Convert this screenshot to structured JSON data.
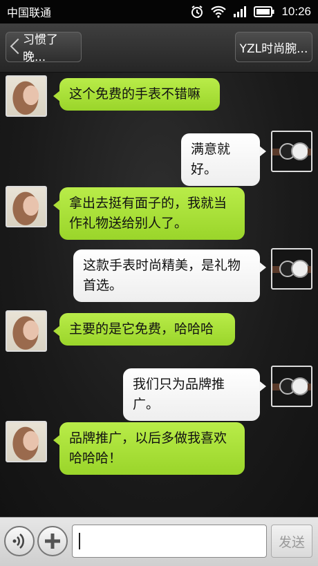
{
  "status_bar": {
    "carrier": "中国联通",
    "time": "10:26",
    "icons": [
      "alarm-icon",
      "wifi-icon",
      "signal-icon",
      "battery-icon"
    ]
  },
  "header": {
    "back_label": "习惯了晚...",
    "contact_label": "YZL时尚腕..."
  },
  "messages": [
    {
      "side": "left",
      "text": "这个免费的手表不错嘛",
      "avatar": "woman-avatar"
    },
    {
      "side": "right",
      "text": "满意就好。",
      "avatar": "watch-avatar"
    },
    {
      "side": "left",
      "text": "拿出去挺有面子的，我就当作礼物送给别人了。",
      "avatar": "woman-avatar"
    },
    {
      "side": "right",
      "text": "这款手表时尚精美，是礼物首选。",
      "avatar": "watch-avatar"
    },
    {
      "side": "left",
      "text": "主要的是它免费，哈哈哈",
      "avatar": "woman-avatar"
    },
    {
      "side": "right",
      "text": "我们只为品牌推广。",
      "avatar": "watch-avatar"
    },
    {
      "side": "left",
      "text": "品牌推广，以后多做我喜欢哈哈哈！",
      "avatar": "woman-avatar"
    }
  ],
  "input_bar": {
    "input_value": "",
    "send_label": "发送",
    "voice_icon": "voice-icon",
    "plus_icon": "plus-icon"
  },
  "colors": {
    "left_bubble": "#a6dc35",
    "right_bubble": "#f4f4f4",
    "background": "#1a1a1a"
  }
}
